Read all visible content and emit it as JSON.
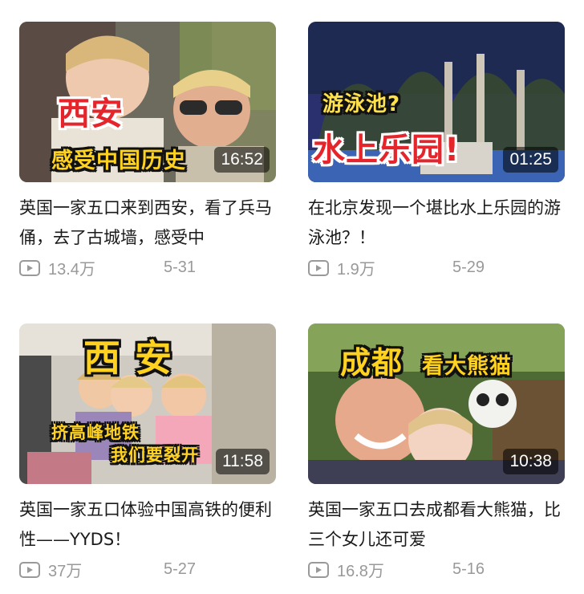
{
  "videos": [
    {
      "title": "英国一家五口来到西安，看了兵马俑，去了古城墙，感受中",
      "duration": "16:52",
      "views": "13.4万",
      "date": "5-31",
      "overlay_text": [
        "西安",
        "感受中国历史"
      ]
    },
    {
      "title": "在北京发现一个堪比水上乐园的游泳池？！",
      "duration": "01:25",
      "views": "1.9万",
      "date": "5-29",
      "overlay_text": [
        "游泳池?",
        "水上乐园!"
      ]
    },
    {
      "title": "英国一家五口体验中国高铁的便利性——YYDS！",
      "duration": "11:58",
      "views": "37万",
      "date": "5-27",
      "overlay_text": [
        "西 安",
        "挤高峰地铁",
        "我们要裂开"
      ]
    },
    {
      "title": "英国一家五口去成都看大熊猫，比三个女儿还可爱",
      "duration": "10:38",
      "views": "16.8万",
      "date": "5-16",
      "overlay_text": [
        "成都",
        "看大熊猫"
      ]
    }
  ],
  "icons": {
    "views": "play-icon"
  },
  "colors": {
    "overlay_red": "#e4262c",
    "overlay_yellow": "#ffd21f",
    "meta_gray": "#999999"
  }
}
